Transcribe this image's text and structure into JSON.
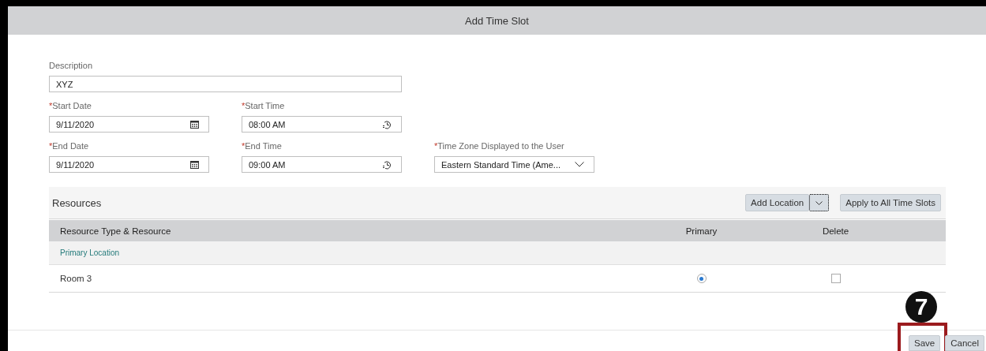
{
  "dialog": {
    "title": "Add Time Slot"
  },
  "form_rows": [
    [
      {
        "kind": "text",
        "label": "Description",
        "value": "XYZ"
      }
    ],
    [
      {
        "kind": "date",
        "required_mark": "*",
        "label": "Start Date",
        "value": "9/11/2020"
      },
      {
        "kind": "time",
        "required_mark": "*",
        "label": "Start Time",
        "value": "08:00 AM"
      }
    ],
    [
      {
        "kind": "date",
        "required_mark": "*",
        "label": "End Date",
        "value": "9/11/2020"
      },
      {
        "kind": "time",
        "required_mark": "*",
        "label": "End Time",
        "value": "09:00 AM"
      },
      {
        "kind": "select",
        "required_mark": "*",
        "label": "Time Zone Displayed to the User",
        "value": "Eastern Standard Time (Ame..."
      }
    ]
  ],
  "resources": {
    "title": "Resources",
    "buttons": [
      {
        "kind": "split",
        "label": "Add Location"
      },
      {
        "kind": "plain",
        "label": "Apply to All Time Slots"
      }
    ],
    "columns": [
      "Resource Type & Resource",
      "Primary",
      "Delete"
    ],
    "groups": [
      {
        "label": "Primary Location",
        "rows": [
          {
            "resource": "Room 3",
            "primary": true,
            "delete": false
          }
        ]
      }
    ]
  },
  "footer_buttons": [
    {
      "label": "Save",
      "highlighted": true,
      "callout": "7"
    },
    {
      "label": "Cancel",
      "highlighted": false
    }
  ]
}
